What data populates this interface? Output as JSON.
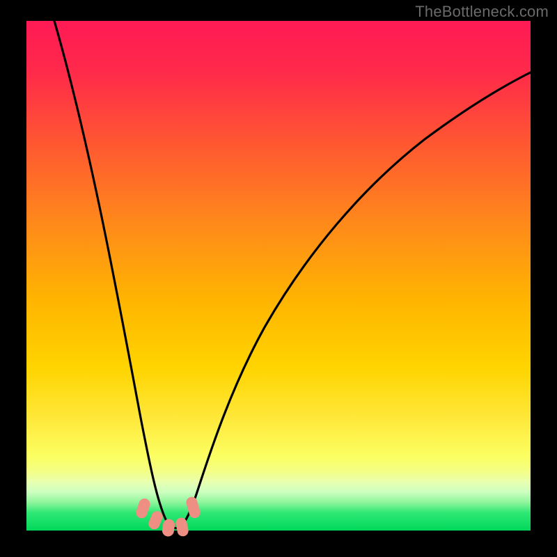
{
  "watermark": "TheBottleneck.com",
  "chart_data": {
    "type": "line",
    "title": "",
    "xlabel": "",
    "ylabel": "",
    "xlim": [
      0,
      100
    ],
    "ylim": [
      0,
      100
    ],
    "grid": false,
    "legend": false,
    "note": "V-shaped bottleneck curve over rainbow gradient. Minimum near x≈27 (≈0%). Values estimated from pixel positions.",
    "series": [
      {
        "name": "bottleneck-curve",
        "x": [
          5,
          10,
          15,
          20,
          23,
          25,
          27,
          29,
          31,
          35,
          40,
          50,
          60,
          70,
          80,
          90,
          100
        ],
        "y": [
          100,
          76,
          52,
          28,
          12,
          4,
          0,
          1,
          5,
          17,
          31,
          51,
          64,
          73,
          79,
          83,
          86
        ]
      }
    ],
    "markers": [
      {
        "x": 22.5,
        "y": 4.5
      },
      {
        "x": 24.5,
        "y": 2.0
      },
      {
        "x": 27.0,
        "y": 1.0
      },
      {
        "x": 29.0,
        "y": 1.5
      },
      {
        "x": 31.5,
        "y": 5.0
      }
    ],
    "colors": {
      "gradient_top": "#ff1a4b",
      "gradient_mid1": "#ff7a1f",
      "gradient_mid2": "#ffd400",
      "gradient_mid3": "#f7ff66",
      "gradient_band": "#e8ffb0",
      "gradient_bottom": "#00e05a",
      "curve": "#000000",
      "marker": "#ef8f84"
    }
  }
}
